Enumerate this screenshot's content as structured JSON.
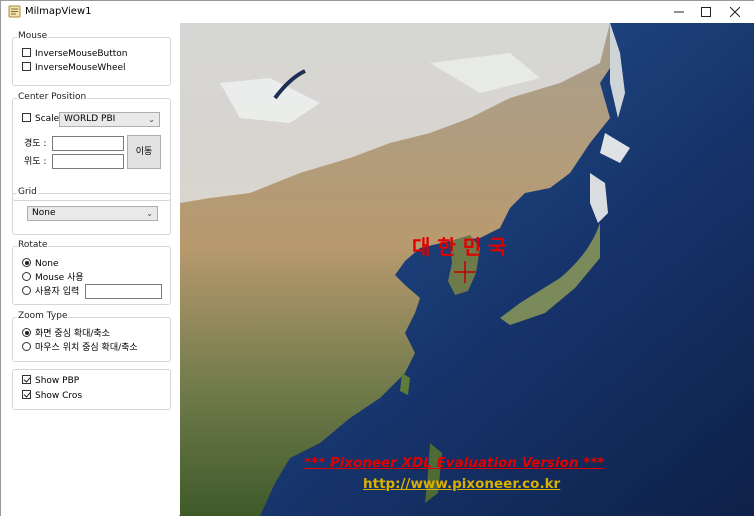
{
  "window": {
    "title": "MilmapView1"
  },
  "mouse": {
    "label": "Mouse",
    "inverse_button": {
      "label": "InverseMouseButton",
      "checked": false
    },
    "inverse_wheel": {
      "label": "InverseMouseWheel",
      "checked": false
    }
  },
  "center": {
    "label": "Center Position",
    "scale": {
      "label": "Scale",
      "checked": false
    },
    "projection": "WORLD PBI",
    "lon_label": "경도 :",
    "lat_label": "위도 :",
    "lon_value": "",
    "lat_value": "",
    "move_button": "이동"
  },
  "grid": {
    "label": "Grid",
    "selected": "None"
  },
  "rotate": {
    "label": "Rotate",
    "options": [
      "None",
      "Mouse 사용",
      "사용자 입력"
    ],
    "selected": "None",
    "user_value": ""
  },
  "zoom": {
    "label": "Zoom Type",
    "options": [
      "화면 중심 확대/축소",
      "마우스 위치 중심 확대/축소"
    ],
    "selected": "화면 중심 확대/축소"
  },
  "display": {
    "show_pbp": {
      "label": "Show PBP",
      "checked": true
    },
    "show_cros": {
      "label": "Show Cros",
      "checked": true
    }
  },
  "map": {
    "country_label": "대한민국",
    "watermark": "*** Pixoneer XDL Evaluation Version ***",
    "url": "http://www.pixoneer.co.kr",
    "colors": {
      "ocean": "#142a55",
      "label": "#e00000",
      "url": "#d9b000"
    }
  }
}
